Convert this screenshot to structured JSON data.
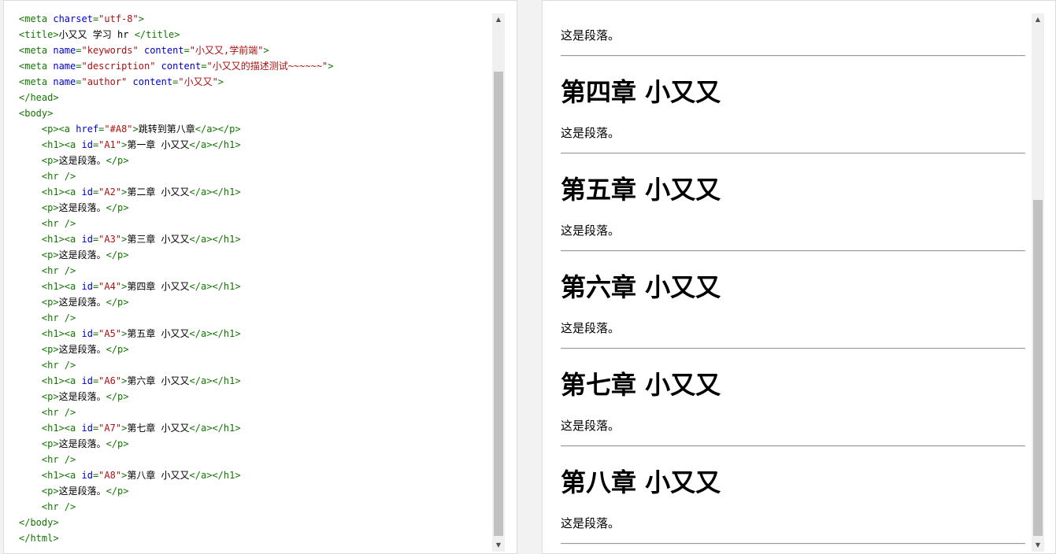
{
  "editor": {
    "lines": [
      [
        [
          "tag",
          "<meta "
        ],
        [
          "attr",
          "charset"
        ],
        [
          "tag",
          "="
        ],
        [
          "str",
          "\"utf-8\""
        ],
        [
          "tag",
          ">"
        ]
      ],
      [
        [
          "tag",
          "<title>"
        ],
        [
          "text",
          "小又又 学习 hr "
        ],
        [
          "tag",
          "</title>"
        ]
      ],
      [
        [
          "tag",
          "<meta "
        ],
        [
          "attr",
          "name"
        ],
        [
          "tag",
          "="
        ],
        [
          "str",
          "\"keywords\""
        ],
        [
          "tag",
          " "
        ],
        [
          "attr",
          "content"
        ],
        [
          "tag",
          "="
        ],
        [
          "str",
          "\"小又又,学前端\""
        ],
        [
          "tag",
          ">"
        ]
      ],
      [
        [
          "tag",
          "<meta "
        ],
        [
          "attr",
          "name"
        ],
        [
          "tag",
          "="
        ],
        [
          "str",
          "\"description\""
        ],
        [
          "tag",
          " "
        ],
        [
          "attr",
          "content"
        ],
        [
          "tag",
          "="
        ],
        [
          "str",
          "\"小又又的描述测试~~~~~~\""
        ],
        [
          "tag",
          ">"
        ]
      ],
      [
        [
          "tag",
          "<meta "
        ],
        [
          "attr",
          "name"
        ],
        [
          "tag",
          "="
        ],
        [
          "str",
          "\"author\""
        ],
        [
          "tag",
          " "
        ],
        [
          "attr",
          "content"
        ],
        [
          "tag",
          "="
        ],
        [
          "str",
          "\"小又又\""
        ],
        [
          "tag",
          ">"
        ]
      ],
      [
        [
          "tag",
          "</head>"
        ]
      ],
      [
        [
          "tag",
          "<body>"
        ]
      ],
      [
        [
          "text",
          "    "
        ],
        [
          "tag",
          "<p><a "
        ],
        [
          "attr",
          "href"
        ],
        [
          "tag",
          "="
        ],
        [
          "str",
          "\"#A8\""
        ],
        [
          "tag",
          ">"
        ],
        [
          "text",
          "跳转到第八章"
        ],
        [
          "tag",
          "</a></p>"
        ]
      ],
      [
        [
          "text",
          "    "
        ],
        [
          "tag",
          "<h1><a "
        ],
        [
          "attr",
          "id"
        ],
        [
          "tag",
          "="
        ],
        [
          "str",
          "\"A1\""
        ],
        [
          "tag",
          ">"
        ],
        [
          "text",
          "第一章 小又又"
        ],
        [
          "tag",
          "</a></h1>"
        ]
      ],
      [
        [
          "text",
          "    "
        ],
        [
          "tag",
          "<p>"
        ],
        [
          "text",
          "这是段落。"
        ],
        [
          "tag",
          "</p>"
        ]
      ],
      [
        [
          "text",
          "    "
        ],
        [
          "tag",
          "<hr />"
        ]
      ],
      [
        [
          "text",
          "    "
        ],
        [
          "tag",
          "<h1><a "
        ],
        [
          "attr",
          "id"
        ],
        [
          "tag",
          "="
        ],
        [
          "str",
          "\"A2\""
        ],
        [
          "tag",
          ">"
        ],
        [
          "text",
          "第二章 小又又"
        ],
        [
          "tag",
          "</a></h1>"
        ]
      ],
      [
        [
          "text",
          "    "
        ],
        [
          "tag",
          "<p>"
        ],
        [
          "text",
          "这是段落。"
        ],
        [
          "tag",
          "</p>"
        ]
      ],
      [
        [
          "text",
          "    "
        ],
        [
          "tag",
          "<hr />"
        ]
      ],
      [
        [
          "text",
          "    "
        ],
        [
          "tag",
          "<h1><a "
        ],
        [
          "attr",
          "id"
        ],
        [
          "tag",
          "="
        ],
        [
          "str",
          "\"A3\""
        ],
        [
          "tag",
          ">"
        ],
        [
          "text",
          "第三章 小又又"
        ],
        [
          "tag",
          "</a></h1>"
        ]
      ],
      [
        [
          "text",
          "    "
        ],
        [
          "tag",
          "<p>"
        ],
        [
          "text",
          "这是段落。"
        ],
        [
          "tag",
          "</p>"
        ]
      ],
      [
        [
          "text",
          "    "
        ],
        [
          "tag",
          "<hr />"
        ]
      ],
      [
        [
          "text",
          "    "
        ],
        [
          "tag",
          "<h1><a "
        ],
        [
          "attr",
          "id"
        ],
        [
          "tag",
          "="
        ],
        [
          "str",
          "\"A4\""
        ],
        [
          "tag",
          ">"
        ],
        [
          "text",
          "第四章 小又又"
        ],
        [
          "tag",
          "</a></h1>"
        ]
      ],
      [
        [
          "text",
          "    "
        ],
        [
          "tag",
          "<p>"
        ],
        [
          "text",
          "这是段落。"
        ],
        [
          "tag",
          "</p>"
        ]
      ],
      [
        [
          "text",
          "    "
        ],
        [
          "tag",
          "<hr />"
        ]
      ],
      [
        [
          "text",
          "    "
        ],
        [
          "tag",
          "<h1><a "
        ],
        [
          "attr",
          "id"
        ],
        [
          "tag",
          "="
        ],
        [
          "str",
          "\"A5\""
        ],
        [
          "tag",
          ">"
        ],
        [
          "text",
          "第五章 小又又"
        ],
        [
          "tag",
          "</a></h1>"
        ]
      ],
      [
        [
          "text",
          "    "
        ],
        [
          "tag",
          "<p>"
        ],
        [
          "text",
          "这是段落。"
        ],
        [
          "tag",
          "</p>"
        ]
      ],
      [
        [
          "text",
          "    "
        ],
        [
          "tag",
          "<hr />"
        ]
      ],
      [
        [
          "text",
          "    "
        ],
        [
          "tag",
          "<h1><a "
        ],
        [
          "attr",
          "id"
        ],
        [
          "tag",
          "="
        ],
        [
          "str",
          "\"A6\""
        ],
        [
          "tag",
          ">"
        ],
        [
          "text",
          "第六章 小又又"
        ],
        [
          "tag",
          "</a></h1>"
        ]
      ],
      [
        [
          "text",
          "    "
        ],
        [
          "tag",
          "<p>"
        ],
        [
          "text",
          "这是段落。"
        ],
        [
          "tag",
          "</p>"
        ]
      ],
      [
        [
          "text",
          "    "
        ],
        [
          "tag",
          "<hr />"
        ]
      ],
      [
        [
          "text",
          "    "
        ],
        [
          "tag",
          "<h1><a "
        ],
        [
          "attr",
          "id"
        ],
        [
          "tag",
          "="
        ],
        [
          "str",
          "\"A7\""
        ],
        [
          "tag",
          ">"
        ],
        [
          "text",
          "第七章 小又又"
        ],
        [
          "tag",
          "</a></h1>"
        ]
      ],
      [
        [
          "text",
          "    "
        ],
        [
          "tag",
          "<p>"
        ],
        [
          "text",
          "这是段落。"
        ],
        [
          "tag",
          "</p>"
        ]
      ],
      [
        [
          "text",
          "    "
        ],
        [
          "tag",
          "<hr />"
        ]
      ],
      [
        [
          "text",
          "    "
        ],
        [
          "tag",
          "<h1><a "
        ],
        [
          "attr",
          "id"
        ],
        [
          "tag",
          "="
        ],
        [
          "str",
          "\"A8\""
        ],
        [
          "tag",
          ">"
        ],
        [
          "text",
          "第八章 小又又"
        ],
        [
          "tag",
          "</a></h1>"
        ]
      ],
      [
        [
          "text",
          "    "
        ],
        [
          "tag",
          "<p>"
        ],
        [
          "text",
          "这是段落。"
        ],
        [
          "tag",
          "</p>"
        ]
      ],
      [
        [
          "text",
          "    "
        ],
        [
          "tag",
          "<hr />"
        ]
      ],
      [
        [
          "tag",
          "</body>"
        ]
      ],
      [
        [
          "tag",
          "</html>"
        ]
      ]
    ]
  },
  "preview": {
    "top_paragraph": "这是段落。",
    "chapters": [
      {
        "heading": "第四章 小又又",
        "paragraph": "这是段落。"
      },
      {
        "heading": "第五章 小又又",
        "paragraph": "这是段落。"
      },
      {
        "heading": "第六章 小又又",
        "paragraph": "这是段落。"
      },
      {
        "heading": "第七章 小又又",
        "paragraph": "这是段落。"
      },
      {
        "heading": "第八章 小又又",
        "paragraph": "这是段落。"
      }
    ]
  },
  "scrollbar": {
    "up_icon": "scroll-up-arrow-icon",
    "down_icon": "scroll-down-arrow-icon"
  }
}
